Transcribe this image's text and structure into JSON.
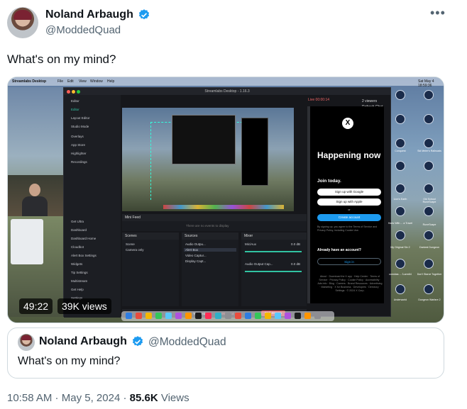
{
  "author": {
    "name": "Noland Arbaugh",
    "handle": "@ModdedQuad",
    "verified_color": "#1d9bf0"
  },
  "tweet": {
    "text": "What's on my mind?",
    "more_label": "•••"
  },
  "media": {
    "duration": "49:22",
    "views": "39K views",
    "screen": {
      "menubar": {
        "app": "Streamlabs Desktop",
        "items": [
          "File",
          "Edit",
          "View",
          "Window",
          "Help"
        ],
        "clock": "Sat May 4 18:59:36"
      },
      "app_title": "Streamlabs Desktop - 1.16.3",
      "sidebar": {
        "items": [
          "Editor",
          "Editor",
          "Layout Editor",
          "Studio Mode",
          "Overlays",
          "App Store",
          "Highlighter",
          "Recordings"
        ],
        "lower": [
          "Get Ultra",
          "Dashboard",
          "Dashboard Home",
          "Cloudbot",
          "Alert Box Settings",
          "Widgets",
          "Tip Settings",
          "Multistream",
          "Get Help",
          "Settings"
        ]
      },
      "mini_feed": {
        "label": "Mini Feed",
        "empty": "There are no events to display"
      },
      "scenes": {
        "label": "Scenes",
        "items": [
          "Scene",
          "Camera only"
        ]
      },
      "sources": {
        "label": "Sources",
        "items": [
          "Audio Outpu...",
          "Alert Box",
          "Video Captur...",
          "Display Capt..."
        ]
      },
      "mixer": {
        "label": "Mixer",
        "items": [
          {
            "name": "Mic/Aux",
            "db": "0.0 dB"
          },
          {
            "name": "Audio Output Cap...",
            "db": "0.0 dB"
          }
        ]
      },
      "bottom_bar": {
        "test_widgets": "Test Widgets",
        "timer": "00:00:14",
        "end_stream": "End Stream"
      },
      "live": {
        "label": "Live 00:00:14",
        "viewers": "2 viewers",
        "refresh": "Refresh Chat"
      },
      "x_signup": {
        "logo": "X",
        "headline": "Happening now",
        "join": "Join today.",
        "google": "Sign up with Google",
        "apple": "Sign up with Apple",
        "or": "or",
        "create": "Create account",
        "terms": "By signing up, you agree to the Terms of Service and Privacy Policy, including Cookie Use.",
        "already": "Already have an account?",
        "signin": "Sign in",
        "footer": "About · Download the X app · Help Center · Terms of Service · Privacy Policy · Cookie Policy · Accessibility · Ads info · Blog · Careers · Brand Resources · Advertising · Marketing · X for Business · Developers · Directory · Settings · © 2024 X Corp."
      },
      "desktop_icons": [
        "Conquest",
        "Sid Meier's Railroads",
        "Lion's Earth",
        "Old School RuneScape",
        "Hoes With ... a Travel",
        "RuneScape",
        "My Original Sin 2",
        "Darkest Dungeon",
        "comidas ... 3-arm64",
        "Don't Starve Together",
        "Underworld",
        "Dungeon Warfare 2"
      ]
    }
  },
  "quote": {
    "name": "Noland Arbaugh",
    "handle": "@ModdedQuad",
    "text": "What's on my mind?"
  },
  "meta": {
    "time": "10:58 AM",
    "sep": " · ",
    "date": "May 5, 2024",
    "views_count": "85.6K",
    "views_label": " Views"
  }
}
